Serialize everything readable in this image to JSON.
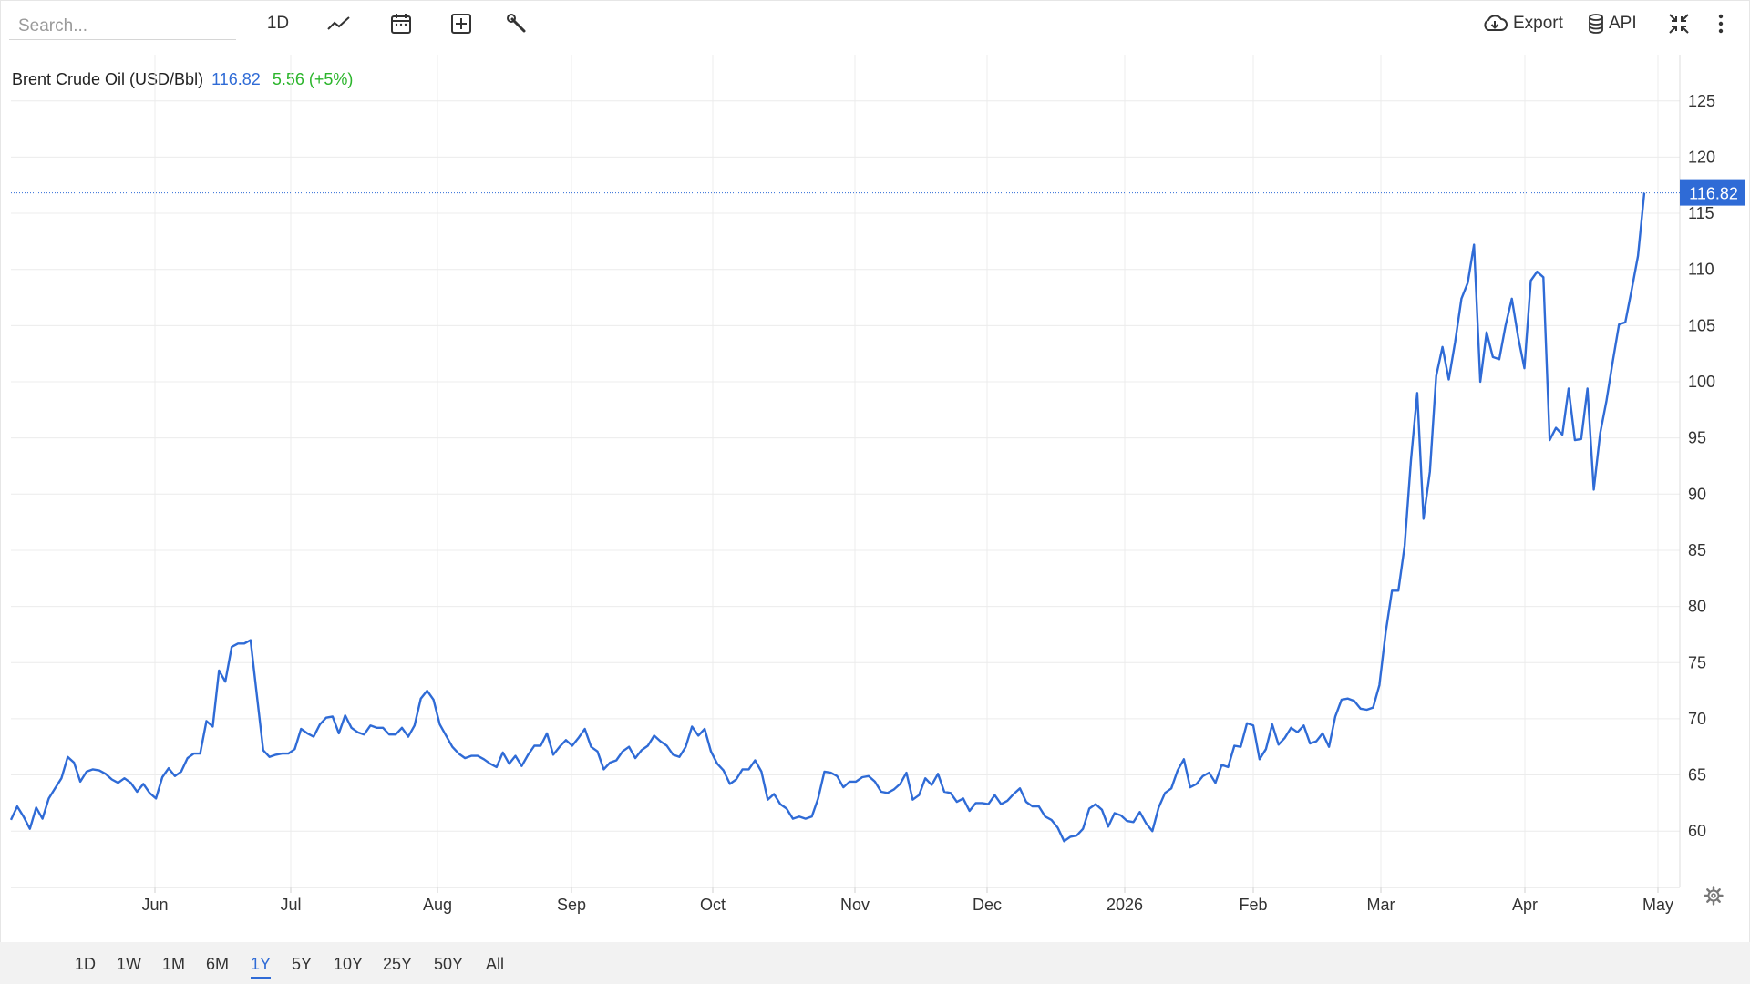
{
  "toolbar": {
    "search_placeholder": "Search...",
    "interval_label": "1D",
    "export_label": "Export",
    "api_label": "API",
    "icons": [
      "line-chart-icon",
      "calendar-icon",
      "add-indicator-icon",
      "wrench-icon",
      "cloud-download-icon",
      "database-icon",
      "collapse-icon",
      "more-vertical-icon"
    ]
  },
  "legend": {
    "name": "Brent Crude Oil (USD/Bbl)",
    "price": "116.82",
    "change": "5.56 (+5%)"
  },
  "colors": {
    "line": "#2f6bd6",
    "change_positive": "#2cb52c",
    "grid": "#ececec"
  },
  "range_buttons": [
    "1D",
    "1W",
    "1M",
    "6M",
    "1Y",
    "5Y",
    "10Y",
    "25Y",
    "50Y",
    "All"
  ],
  "active_range": "1Y",
  "chart_data": {
    "type": "line",
    "title": "Brent Crude Oil (USD/Bbl)",
    "xlabel": "",
    "ylabel": "",
    "ylim": [
      55,
      128
    ],
    "y_ticks": [
      60,
      65,
      70,
      75,
      80,
      85,
      90,
      95,
      100,
      105,
      110,
      115,
      120,
      125
    ],
    "x_ticks": [
      "Jun",
      "Jul",
      "Aug",
      "Sep",
      "Oct",
      "Nov",
      "Dec",
      "2026",
      "Feb",
      "Mar",
      "Apr",
      "May"
    ],
    "grid": true,
    "last_value": "116.82",
    "series": [
      {
        "values": [
          61.0,
          62.2,
          61.3,
          60.2,
          62.1,
          61.1,
          62.9,
          63.8,
          64.7,
          66.6,
          66.1,
          64.4,
          65.3,
          65.5,
          65.4,
          65.1,
          64.6,
          64.3,
          64.7,
          64.3,
          63.5,
          64.2,
          63.4,
          62.9,
          64.8,
          65.6,
          64.9,
          65.3,
          66.5,
          66.9,
          66.9,
          69.8,
          69.3,
          74.3,
          73.3,
          76.4,
          76.7,
          76.7,
          77.0,
          72.1,
          67.2,
          66.6,
          66.8,
          66.9,
          66.9,
          67.3,
          69.1,
          68.7,
          68.4,
          69.5,
          70.1,
          70.2,
          68.7,
          70.3,
          69.2,
          68.8,
          68.6,
          69.4,
          69.2,
          69.2,
          68.6,
          68.6,
          69.2,
          68.4,
          69.4,
          71.8,
          72.5,
          71.7,
          69.5,
          68.5,
          67.5,
          66.9,
          66.5,
          66.7,
          66.7,
          66.4,
          66.0,
          65.7,
          67.0,
          66.0,
          66.7,
          65.8,
          66.8,
          67.6,
          67.6,
          68.7,
          66.8,
          67.5,
          68.1,
          67.6,
          68.3,
          69.1,
          67.5,
          67.1,
          65.5,
          66.1,
          66.3,
          67.1,
          67.5,
          66.5,
          67.2,
          67.6,
          68.5,
          68.0,
          67.6,
          66.8,
          66.6,
          67.5,
          69.3,
          68.5,
          69.1,
          67.1,
          66.0,
          65.4,
          64.2,
          64.6,
          65.5,
          65.5,
          66.3,
          65.3,
          62.8,
          63.3,
          62.4,
          62.0,
          61.1,
          61.3,
          61.1,
          61.3,
          62.9,
          65.3,
          65.2,
          64.9,
          63.9,
          64.4,
          64.4,
          64.8,
          64.9,
          64.4,
          63.5,
          63.4,
          63.7,
          64.2,
          65.2,
          62.8,
          63.2,
          64.7,
          64.1,
          65.1,
          63.5,
          63.4,
          62.6,
          62.9,
          61.8,
          62.5,
          62.5,
          62.4,
          63.2,
          62.4,
          62.7,
          63.3,
          63.8,
          62.6,
          62.2,
          62.2,
          61.3,
          61.0,
          60.3,
          59.1,
          59.5,
          59.6,
          60.2,
          62.0,
          62.4,
          61.9,
          60.4,
          61.6,
          61.4,
          60.9,
          60.8,
          61.7,
          60.7,
          60.0,
          62.1,
          63.4,
          63.8,
          65.4,
          66.4,
          63.9,
          64.2,
          64.9,
          65.2,
          64.3,
          65.9,
          65.7,
          67.6,
          67.5,
          69.6,
          69.4,
          66.4,
          67.3,
          69.5,
          67.7,
          68.3,
          69.2,
          68.8,
          69.4,
          67.8,
          68.0,
          68.7,
          67.5,
          70.2,
          71.7,
          71.8,
          71.6,
          70.9,
          70.8,
          71.0,
          73.0,
          77.7,
          81.4,
          81.4,
          85.4,
          93.0,
          99.0,
          87.8,
          92.0,
          100.5,
          103.1,
          100.2,
          103.5,
          107.4,
          108.8,
          112.2,
          100.0,
          104.4,
          102.2,
          102.0,
          105.0,
          107.4,
          104.0,
          101.2,
          109.0,
          109.8,
          109.3,
          94.8,
          95.9,
          95.3,
          99.4,
          94.8,
          94.9,
          99.4,
          90.4,
          95.4,
          98.3,
          101.8,
          105.1,
          105.3,
          108.2,
          111.2,
          116.82
        ]
      }
    ]
  }
}
